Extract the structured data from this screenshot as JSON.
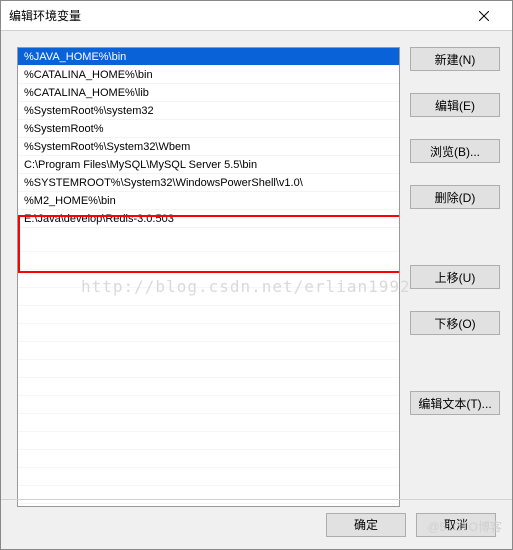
{
  "window": {
    "title": "编辑环境变量"
  },
  "list": {
    "items": [
      "%JAVA_HOME%\\bin",
      "%CATALINA_HOME%\\bin",
      "%CATALINA_HOME%\\lib",
      "%SystemRoot%\\system32",
      "%SystemRoot%",
      "%SystemRoot%\\System32\\Wbem",
      "C:\\Program Files\\MySQL\\MySQL Server 5.5\\bin",
      "%SYSTEMROOT%\\System32\\WindowsPowerShell\\v1.0\\",
      "%M2_HOME%\\bin",
      "E:\\Java\\develop\\Redis-3.0.503"
    ],
    "selectedIndex": 0
  },
  "buttons": {
    "new": "新建(N)",
    "edit": "编辑(E)",
    "browse": "浏览(B)...",
    "delete": "删除(D)",
    "moveUp": "上移(U)",
    "moveDown": "下移(O)",
    "editText": "编辑文本(T)...",
    "ok": "确定",
    "cancel": "取消"
  },
  "watermark": {
    "url": "http://blog.csdn.net/erlian1992",
    "brand": "@51CTO博客"
  }
}
